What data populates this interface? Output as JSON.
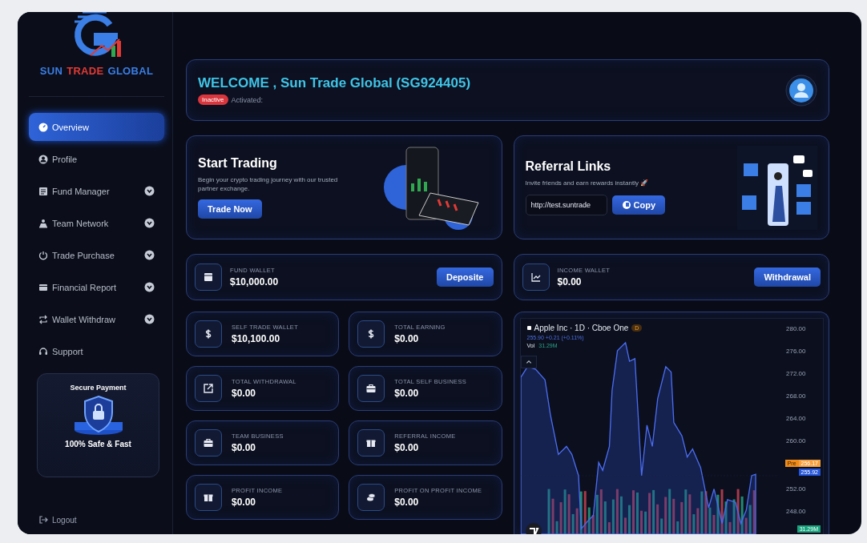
{
  "brand": {
    "words": [
      {
        "text": "SUN",
        "color": "#3a7ee6"
      },
      {
        "text": "TRADE",
        "color": "#e23a34"
      },
      {
        "text": "GLOBAL",
        "color": "#3a7ee6"
      }
    ]
  },
  "sidebar": {
    "items": [
      {
        "label": "Overview",
        "kind": "gauge",
        "selected": true
      },
      {
        "label": "Profile",
        "kind": "user",
        "selected": false
      },
      {
        "label": "Fund Manager",
        "kind": "doc",
        "selected": false,
        "expanded": false
      },
      {
        "label": "Team Network",
        "kind": "team",
        "selected": false,
        "expanded": false
      },
      {
        "label": "Trade Purchase",
        "kind": "power",
        "selected": false,
        "expanded": false
      },
      {
        "label": "Financial Report",
        "kind": "card",
        "selected": false,
        "expanded": false
      },
      {
        "label": "Wallet Withdraw",
        "kind": "swap",
        "selected": false,
        "expanded": false
      },
      {
        "label": "Support",
        "kind": "headset",
        "selected": false
      }
    ],
    "secure_card": {
      "title": "Secure Payment",
      "subtitle": "100% Safe & Fast"
    },
    "logout": "Logout"
  },
  "welcome": {
    "greeting": "WELCOME , Sun Trade Global (SG924405)",
    "status": "Inactive",
    "activated_label": "Activated:"
  },
  "start_trading": {
    "title": "Start Trading",
    "text": "Begin your crypto trading journey with our trusted partner exchange.",
    "button": "Trade Now"
  },
  "referral": {
    "title": "Referral Links",
    "text": "Invite friends and earn rewards instantly 🚀",
    "link": "http://test.suntrade",
    "button": "Copy"
  },
  "wallets": [
    {
      "label": "FUND WALLET",
      "amount": "$10,000.00",
      "kind": "wallet",
      "button": "Deposite"
    },
    {
      "label": "INCOME WALLET",
      "amount": "$0.00",
      "kind": "chart",
      "button": "Withdrawal"
    }
  ],
  "stats": [
    {
      "label": "SELF TRADE WALLET",
      "amount": "$10,100.00",
      "kind": "dollar"
    },
    {
      "label": "TOTAL EARNING",
      "amount": "$0.00",
      "kind": "dollar"
    },
    {
      "label": "TOTAL WITHDRAWAL",
      "amount": "$0.00",
      "kind": "export"
    },
    {
      "label": "TOTAL SELF BUSINESS",
      "amount": "$0.00",
      "kind": "briefcase"
    },
    {
      "label": "TEAM BUSINESS",
      "amount": "$0.00",
      "kind": "briefcase"
    },
    {
      "label": "REFERRAL INCOME",
      "amount": "$0.00",
      "kind": "gift"
    },
    {
      "label": "PROFIT INCOME",
      "amount": "$0.00",
      "kind": "gift"
    },
    {
      "label": "PROFIT ON PROFIT INCOME",
      "amount": "$0.00",
      "kind": "coins"
    }
  ],
  "price_chart": {
    "symbol": "Apple Inc · 1D · Cboe One",
    "badge": "D",
    "quote": "255.90 +0.21 (+0.11%)",
    "volume_label": "Vol",
    "volume": "31.29M",
    "price_axis": [
      "280.00",
      "276.00",
      "272.00",
      "268.00",
      "264.00",
      "260.00",
      "252.00",
      "248.00"
    ],
    "price_tags": [
      {
        "kind": "pre",
        "label": "Pre",
        "value": "256.17"
      },
      {
        "kind": "last",
        "value": "255.92"
      },
      {
        "kind": "volume",
        "value": "31.29M"
      }
    ]
  }
}
